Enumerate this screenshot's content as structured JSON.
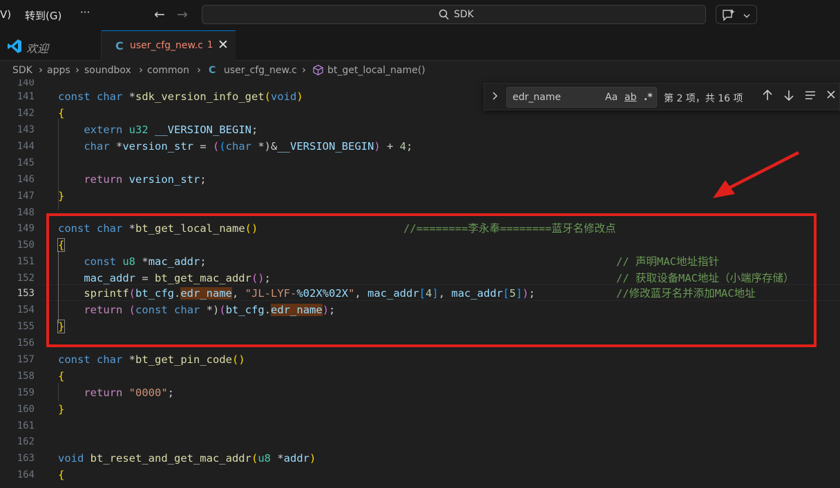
{
  "titlebar": {
    "menu_partial": "V)",
    "menu_goto": "转到(G)",
    "more": "···",
    "search_text": "SDK",
    "back": "←",
    "forward": "→"
  },
  "tabs": {
    "welcome": "欢迎",
    "file_lang": "C",
    "file": "user_cfg_new.c",
    "file_badge": "1",
    "close": "✕"
  },
  "breadcrumb": {
    "items": [
      "SDK",
      "apps",
      "soundbox",
      "common",
      "user_cfg_new.c",
      "bt_get_local_name()"
    ],
    "file_lang": "C"
  },
  "find": {
    "value": "edr_name",
    "match_case": "Aa",
    "whole_word": "ab",
    "regex": ".*",
    "count": "第 2 项，共 16 项"
  },
  "lines": {
    "n140": "140",
    "n141": "141",
    "n142": "142",
    "n143": "143",
    "n144": "144",
    "n145": "145",
    "n146": "146",
    "n147": "147",
    "n148": "148",
    "n149": "149",
    "n150": "150",
    "n151": "151",
    "n152": "152",
    "n153": "153",
    "n154": "154",
    "n155": "155",
    "n156": "156",
    "n157": "157",
    "n158": "158",
    "n159": "159",
    "n160": "160",
    "n161": "161",
    "n162": "162",
    "n163": "163",
    "n164": "164"
  },
  "code": {
    "const": "const",
    "char": "char",
    "void": "void",
    "extern": "extern",
    "return": "return",
    "u32": "u32",
    "u8": "u8",
    "star": " *",
    "star2": " *)",
    "sp": " ",
    "f_sdk_version": "sdk_version_info_get",
    "f_bt_get_local_name": "bt_get_local_name",
    "f_bt_get_pin_code": "bt_get_pin_code",
    "f_bt_reset": "bt_reset_and_get_mac_addr",
    "f_bt_get_mac_addr": "bt_get_mac_addr",
    "f_sprintf": "sprintf",
    "version_begin": "__VERSION_BEGIN",
    "version_str": "version_str",
    "mac_addr": "mac_addr",
    "bt_cfg": "bt_cfg",
    "edr_name": "edr_name",
    "addr": "addr",
    "fmt": "\"JL-LYF-",
    "fmt_spec": "%02X%02X",
    "fmt_end": "\"",
    "pin": "\"0000\"",
    "four": "4",
    "five": "5",
    "comment_149": "//========李永奉========蓝牙名修改点",
    "comment_151": "// 声明MAC地址指针",
    "comment_152": "// 获取设备MAC地址（小端序存储）",
    "comment_153": "//修改蓝牙名并添加MAC地址"
  }
}
